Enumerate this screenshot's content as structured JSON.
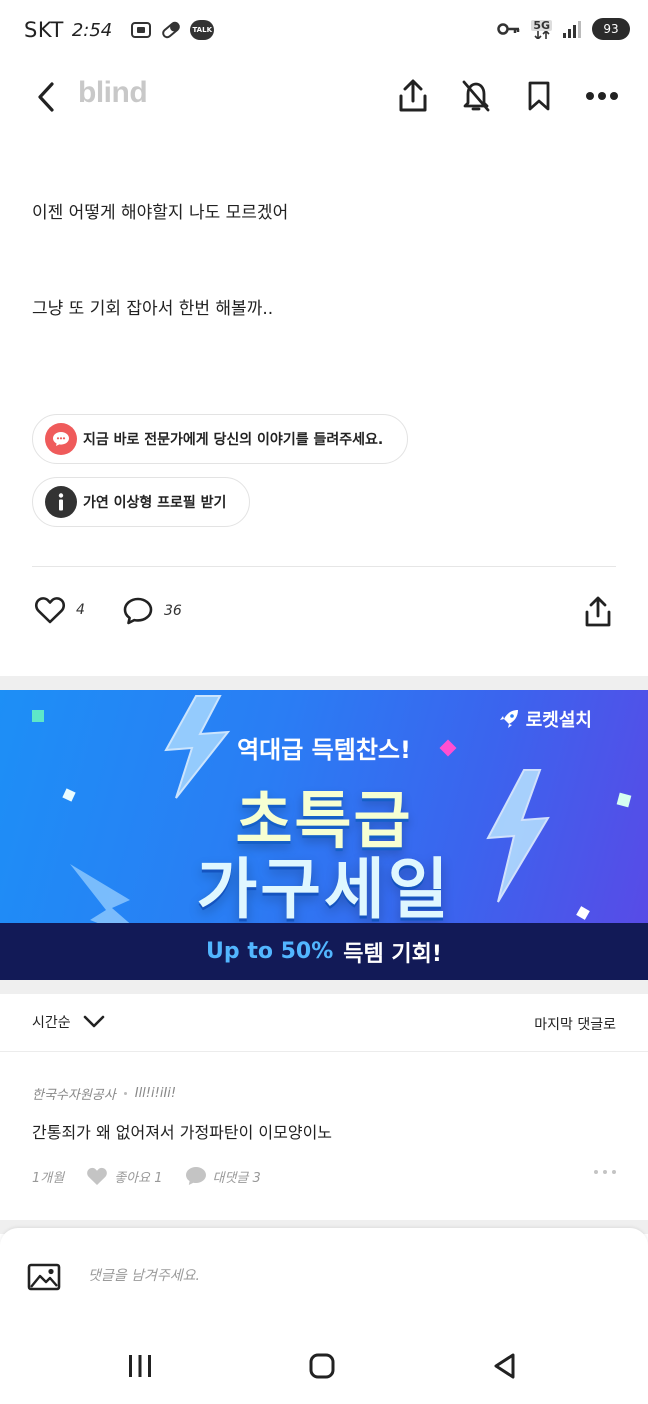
{
  "status_bar": {
    "carrier": "SKT",
    "time": "2:54",
    "talk_badge": "TALK",
    "network": "5G",
    "battery": "93",
    "icons": [
      "screenshot-icon",
      "pill-icon",
      "talk-icon",
      "key-icon",
      "5g-icon",
      "signal-icon",
      "battery-icon"
    ]
  },
  "header": {
    "logo": "blind",
    "icons": [
      "back-icon",
      "share-icon",
      "notification-off-icon",
      "bookmark-icon",
      "more-icon"
    ]
  },
  "post": {
    "lines": [
      "이젠 어떻게 해야할지 나도 모르겠어",
      "그냥 또 기회 잡아서 한번 해볼까.."
    ],
    "chips": [
      {
        "label": "지금 바로 전문가에게 당신의 이야기를 들려주세요.",
        "icon": "chat-bubble-icon",
        "color": "#ef5b5b"
      },
      {
        "label": "가연 이상형 프로필 받기",
        "icon": "info-icon",
        "color": "#333333"
      }
    ]
  },
  "actions": {
    "likes": "4",
    "comments": "36"
  },
  "ad": {
    "brand": "로켓설치",
    "headline": "역대급 득템찬스!",
    "title_line1": "초특급",
    "title_line2": "가구세일",
    "bottom_a": "Up to 50%",
    "bottom_b": "득템 기회!",
    "colors": {
      "bg_start": "#1d8ff6",
      "bg_end": "#5a49e6",
      "bottom": "#121a57",
      "accent": "#52b6ff"
    }
  },
  "sort": {
    "label": "시간순",
    "right_label": "마지막 댓글로"
  },
  "comments": [
    {
      "company": "한국수자원공사",
      "author": "Ill!i!iIi!",
      "text": "간통죄가 왜 없어져서 가정파탄이 이모양이노",
      "time": "1개월",
      "like_label": "좋아요 1",
      "reply_label": "대댓글 3"
    }
  ],
  "composer": {
    "placeholder": "댓글을 남겨주세요."
  },
  "nav": {
    "icons": [
      "recent-apps-icon",
      "home-icon",
      "back-nav-icon"
    ]
  }
}
